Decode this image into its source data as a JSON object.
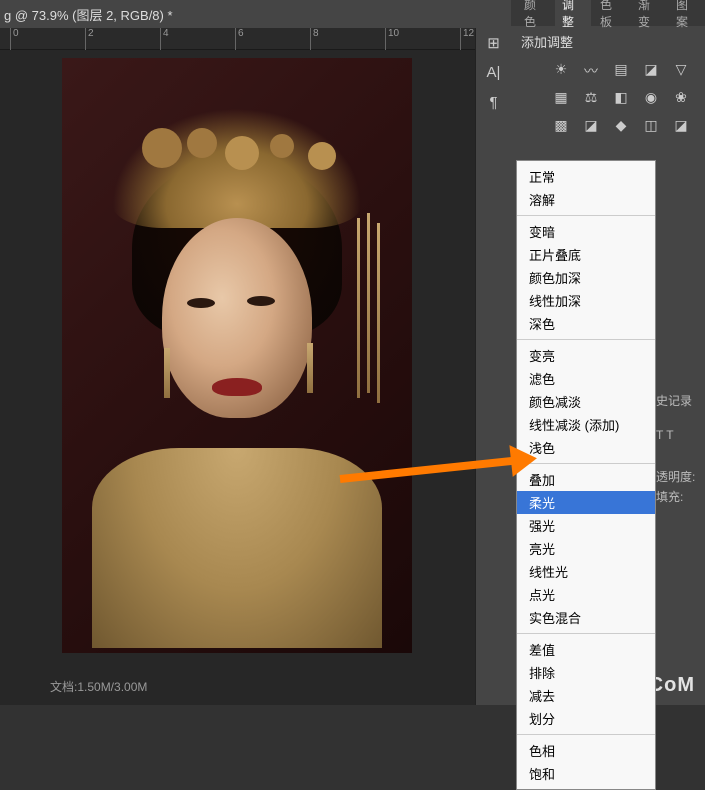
{
  "title": "g @ 73.9% (图层 2, RGB/8) *",
  "ruler_ticks": [
    "0",
    "2",
    "4",
    "6",
    "8",
    "10",
    "12"
  ],
  "status": "文档:1.50M/3.00M",
  "strip_icons": [
    "panel-icon",
    "text-icon",
    "paragraph-icon"
  ],
  "panel": {
    "tabs": [
      "颜色",
      "调整",
      "色板",
      "渐变",
      "图案"
    ],
    "active_tab": "调整",
    "title": "添加调整"
  },
  "adjust_icons": [
    "☀",
    "〰",
    "▤",
    "◪",
    "▽",
    "▦",
    "⚖",
    "◧",
    "◉",
    "❀",
    "▩",
    "◪",
    "◆",
    "◫",
    "◪"
  ],
  "blend_modes": {
    "groups": [
      [
        "正常",
        "溶解"
      ],
      [
        "变暗",
        "正片叠底",
        "颜色加深",
        "线性加深",
        "深色"
      ],
      [
        "变亮",
        "滤色",
        "颜色减淡",
        "线性减淡 (添加)",
        "浅色"
      ],
      [
        "叠加",
        "柔光",
        "强光",
        "亮光",
        "线性光",
        "点光",
        "实色混合"
      ],
      [
        "差值",
        "排除",
        "减去",
        "划分"
      ],
      [
        "色相",
        "饱和"
      ]
    ],
    "selected": "柔光"
  },
  "side_labels": {
    "history": "史记录",
    "tt": "T  T",
    "opacity": "透明度:",
    "fill": "填充:"
  },
  "watermark": "UiBQ.CoM"
}
